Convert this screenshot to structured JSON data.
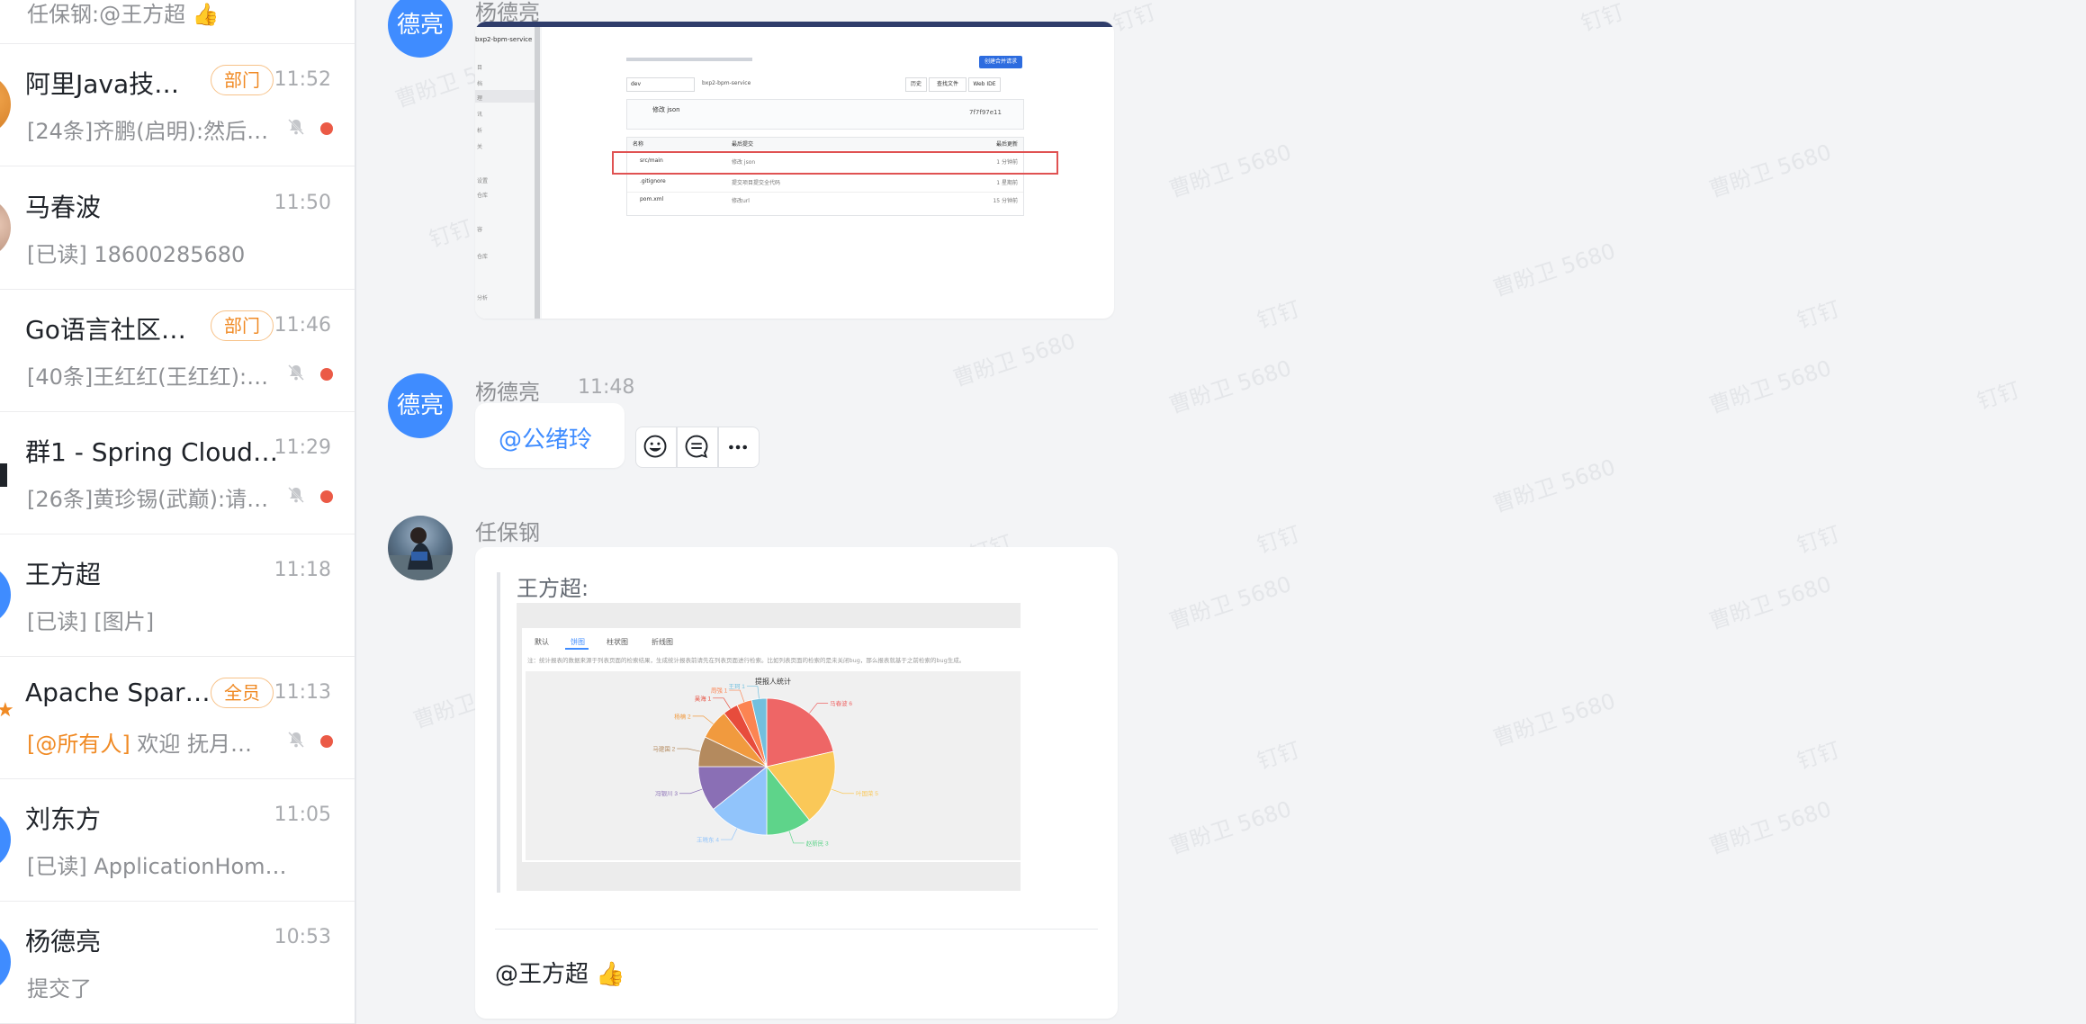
{
  "sidebar": {
    "top_preview": "任保钢:@王方超 👍",
    "conversations": [
      {
        "name": "阿里Java技…",
        "tag": "部门",
        "time": "11:52",
        "preview": "[24条]齐鹏(启明):然后…",
        "muted": true,
        "unread": true
      },
      {
        "name": "马春波",
        "tag": "",
        "time": "11:50",
        "preview": "[已读] 18600285680",
        "muted": false,
        "unread": false
      },
      {
        "name": "Go语言社区…",
        "tag": "部门",
        "time": "11:46",
        "preview": "[40条]王红红(王红红):…",
        "muted": true,
        "unread": true
      },
      {
        "name": "群1 - Spring Cloud…",
        "tag": "",
        "time": "11:29",
        "preview": "[26条]黄珍锡(武巅):请…",
        "muted": true,
        "unread": true
      },
      {
        "name": "王方超",
        "tag": "",
        "time": "11:18",
        "preview": "[已读] [图片]",
        "muted": false,
        "unread": false
      },
      {
        "name": "Apache Spar…",
        "tag": "全员",
        "time": "11:13",
        "preview_mention": "[@所有人]",
        "preview": " 欢迎 抚月…",
        "muted": true,
        "unread": true
      },
      {
        "name": "刘东方",
        "tag": "",
        "time": "11:05",
        "preview": "[已读] ApplicationHom…",
        "muted": false,
        "unread": false
      },
      {
        "name": "杨德亮",
        "tag": "",
        "time": "10:53",
        "preview": "提交了",
        "muted": false,
        "unread": false
      }
    ]
  },
  "chat": {
    "watermark_a": "曹盼卫 5680",
    "watermark_b": "钉钉",
    "msg1": {
      "avatar_text": "德亮",
      "sender": "杨德亮"
    },
    "screenshot1": {
      "title": "bxp2-bpm-service",
      "sidebar_items": [
        "目",
        "档",
        "理",
        "讯",
        "析",
        "关",
        "设置",
        "仓库",
        "容",
        "仓库",
        "分析"
      ],
      "new_btn": "创建合并请求",
      "branch": "dev",
      "path": "bxp2-bpm-service",
      "btn1": "历史",
      "btn2": "查找文件",
      "btn3": "Web IDE",
      "commit_name": "修改 json",
      "commit_hash": "7f7f97e11",
      "col_name": "名称",
      "col_commit": "最后提交",
      "col_update": "最后更新",
      "rows": [
        {
          "name": "src/main",
          "commit": "修改 json",
          "time": "1 分钟前"
        },
        {
          "name": ".gitignore",
          "commit": "提交项目提交全代码",
          "time": "1 星期前"
        },
        {
          "name": "pom.xml",
          "commit": "修改url",
          "time": "15 分钟前"
        }
      ]
    },
    "msg2": {
      "avatar_text": "德亮",
      "sender": "杨德亮",
      "time": "11:48",
      "mention": "@公绪玲"
    },
    "msg3": {
      "sender": "任保钢",
      "quote_author": "王方超:",
      "tabs": [
        "默认",
        "饼图",
        "柱状图",
        "折线图"
      ],
      "note": "注：统计报表的数据来源于列表页面的检索结果，生成统计报表前请先在列表页面进行检索。比如列表页面的检索的是未关闭bug，那么报表就基于之前检索的bug生成。",
      "chart_title": "提报人统计",
      "reply": "@王方超 👍"
    }
  },
  "chart_data": {
    "type": "pie",
    "title": "提报人统计",
    "categories": [
      "马春波",
      "叶国荣",
      "赵新民",
      "王晓东",
      "冯银川",
      "马建国",
      "杨楠",
      "吴海",
      "周强",
      "王珂"
    ],
    "values": [
      6,
      5,
      3,
      4,
      3,
      2,
      2,
      1,
      1,
      1
    ],
    "colors": [
      "#ee6666",
      "#fac858",
      "#5ed48a",
      "#91c4fb",
      "#8a6fb5",
      "#b48a5e",
      "#f19a3e",
      "#e74c3c",
      "#fc8452",
      "#73c0de"
    ]
  }
}
